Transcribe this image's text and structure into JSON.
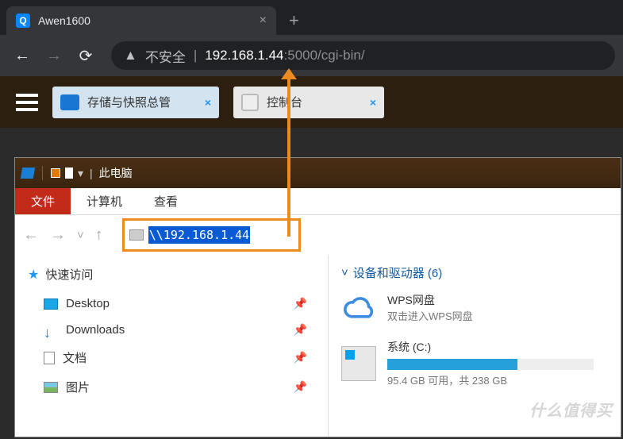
{
  "browser": {
    "tab_title": "Awen1600",
    "security_label": "不安全",
    "url_ip": "192.168.1.44",
    "url_rest": ":5000/cgi-bin/"
  },
  "app": {
    "tab1_label": "存储与快照总管",
    "tab2_label": "控制台"
  },
  "explorer": {
    "title": "此电脑",
    "menu": {
      "file": "文件",
      "computer": "计算机",
      "view": "查看"
    },
    "address_value": "\\\\192.168.1.44",
    "quick_access": "快速访问",
    "items": [
      {
        "label": "Desktop"
      },
      {
        "label": "Downloads"
      },
      {
        "label": "文档"
      },
      {
        "label": "图片"
      }
    ],
    "section_header": "设备和驱动器 (6)",
    "devices": {
      "wps": {
        "title": "WPS网盘",
        "sub": "双击进入WPS网盘"
      },
      "c": {
        "title": "系统 (C:)",
        "usage": "95.4 GB 可用，共 238 GB"
      }
    }
  },
  "watermark": "什么值得买"
}
